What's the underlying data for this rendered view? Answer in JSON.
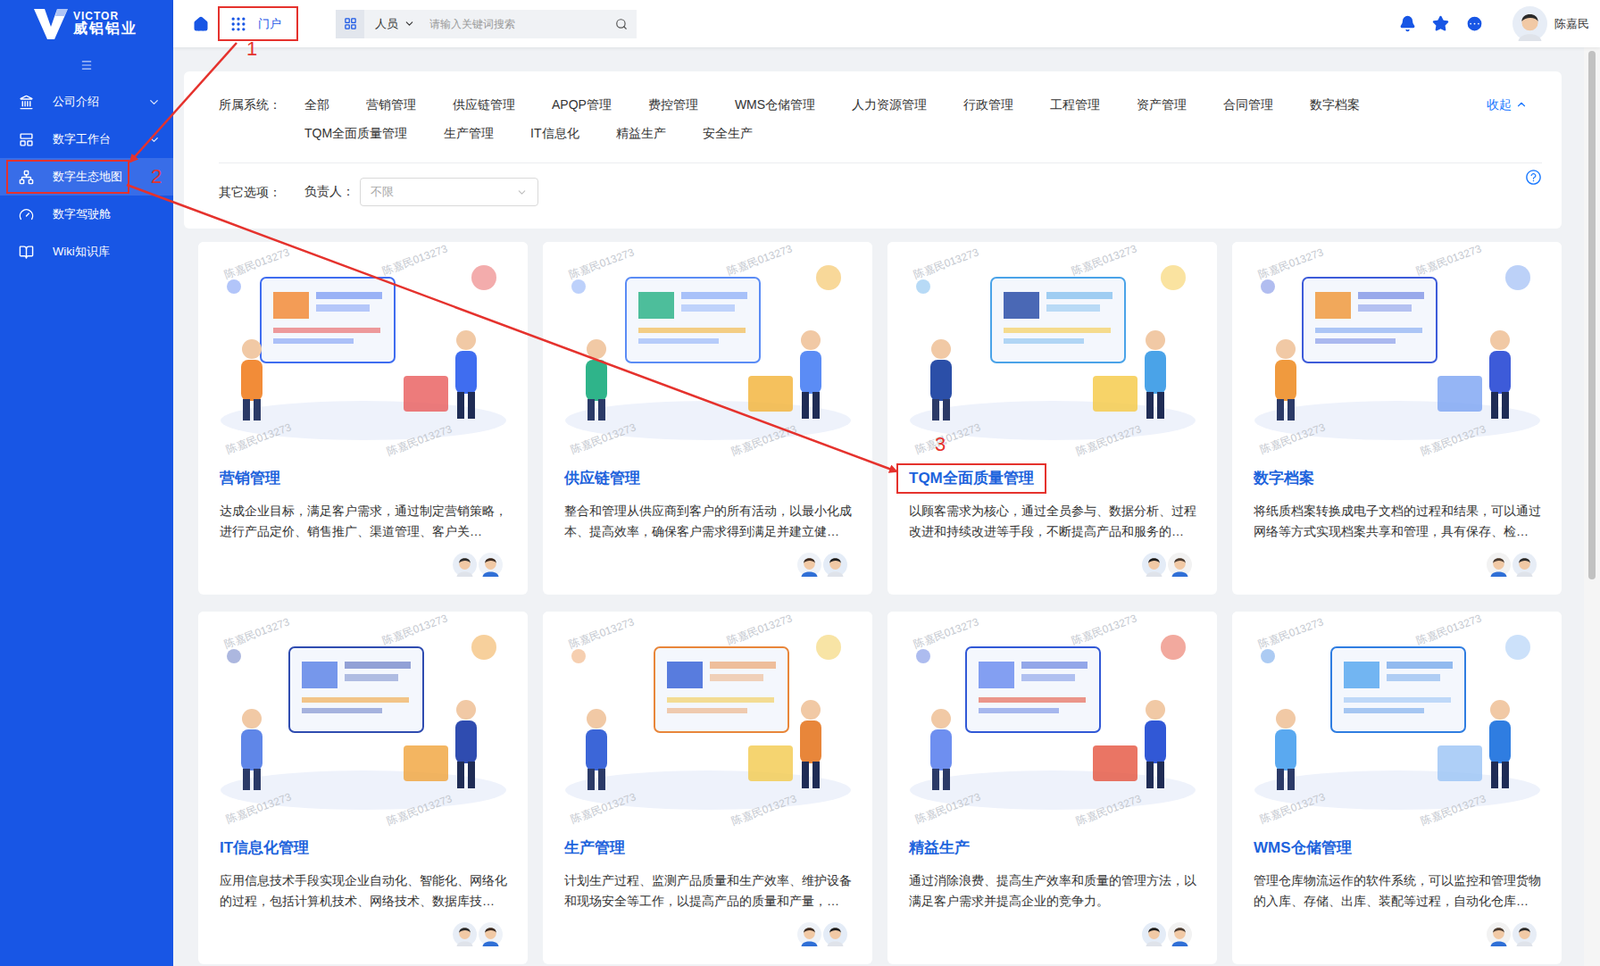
{
  "logo": {
    "brand": "VICTOR",
    "name": "威铝铝业"
  },
  "header": {
    "portal": {
      "label": "门户",
      "annotation": "1"
    },
    "search": {
      "scope": "人员",
      "placeholder": "请输入关键词搜索"
    },
    "user": {
      "name": "陈嘉民"
    }
  },
  "sidebar": {
    "items": [
      {
        "label": "公司介绍",
        "expandable": true,
        "selected": false
      },
      {
        "label": "数字工作台",
        "expandable": true,
        "selected": false
      },
      {
        "label": "数字生态地图",
        "expandable": false,
        "selected": true,
        "annotation": "2"
      },
      {
        "label": "数字驾驶舱",
        "expandable": false,
        "selected": false
      },
      {
        "label": "Wiki知识库",
        "expandable": false,
        "selected": false
      }
    ]
  },
  "filter": {
    "system_label": "所属系统：",
    "systems": [
      "全部",
      "营销管理",
      "供应链管理",
      "APQP管理",
      "费控管理",
      "WMS仓储管理",
      "人力资源管理",
      "行政管理",
      "工程管理",
      "资产管理",
      "合同管理",
      "数字档案",
      "TQM全面质量管理",
      "生产管理",
      "IT信息化",
      "精益生产",
      "安全生产"
    ],
    "collapse": "收起",
    "other_label": "其它选项：",
    "owner_label": "负责人：",
    "owner_placeholder": "不限"
  },
  "cards": [
    {
      "title": "营销管理",
      "description": "达成企业目标，满足客户需求，通过制定营销策略，进行产品定价、销售推广、渠道管理、客户关…",
      "avatars": 2
    },
    {
      "title": "供应链管理",
      "description": "整合和管理从供应商到客户的所有活动，以最小化成本、提高效率，确保客户需求得到满足并建立健…",
      "avatars": 2
    },
    {
      "title": "TQM全面质量管理",
      "description": "以顾客需求为核心，通过全员参与、数据分析、过程改进和持续改进等手段，不断提高产品和服务的…",
      "avatars": 2,
      "annotation": "3"
    },
    {
      "title": "数字档案",
      "description": "将纸质档案转换成电子文档的过程和结果，可以通过网络等方式实现档案共享和管理，具有保存、检…",
      "avatars": 2
    },
    {
      "title": "IT信息化管理",
      "description": "应用信息技术手段实现企业自动化、智能化、网络化的过程，包括计算机技术、网络技术、数据库技…",
      "avatars": 2
    },
    {
      "title": "生产管理",
      "description": "计划生产过程、监测产品质量和生产效率、维护设备和现场安全等工作，以提高产品的质量和产量，…",
      "avatars": 2
    },
    {
      "title": "精益生产",
      "description": "通过消除浪费、提高生产效率和质量的管理方法，以满足客户需求并提高企业的竞争力。",
      "avatars": 2
    },
    {
      "title": "WMS仓储管理",
      "description": "管理仓库物流运作的软件系统，可以监控和管理货物的入库、存储、出库、装配等过程，自动化仓库…",
      "avatars": 2
    }
  ],
  "scrollbar": {
    "level": 0.58
  },
  "watermark": "陈嘉民013273"
}
